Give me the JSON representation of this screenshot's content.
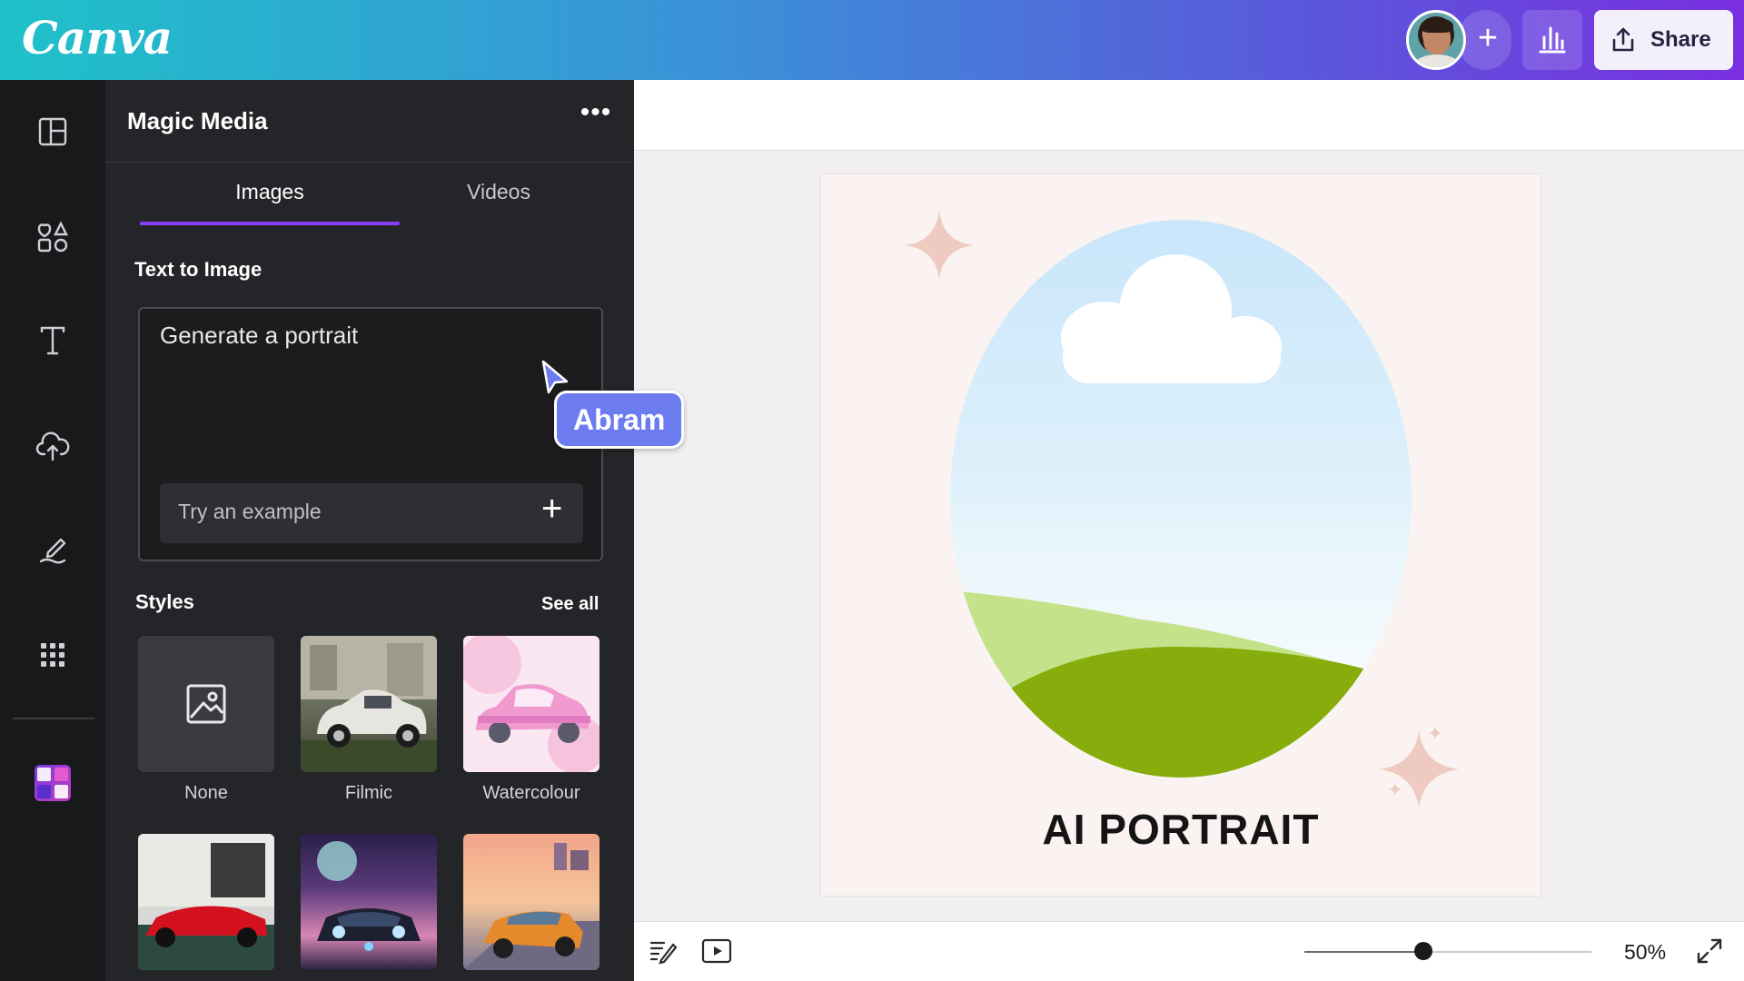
{
  "app": {
    "logo": "Canva"
  },
  "topbar": {
    "share_label": "Share",
    "add_symbol": "+"
  },
  "panel": {
    "title": "Magic Media",
    "more_symbol": "•••",
    "tabs": [
      {
        "label": "Images",
        "active": true
      },
      {
        "label": "Videos",
        "active": false
      }
    ],
    "text_to_image": {
      "heading": "Text to Image",
      "prompt_value": "Generate a portrait",
      "example_label": "Try an example",
      "example_symbol": "+"
    },
    "styles": {
      "heading": "Styles",
      "see_all": "See all",
      "items": [
        {
          "label": "None"
        },
        {
          "label": "Filmic"
        },
        {
          "label": "Watercolour"
        },
        {
          "label": ""
        },
        {
          "label": ""
        },
        {
          "label": ""
        }
      ]
    }
  },
  "collaborator": {
    "name": "Abram"
  },
  "canvas": {
    "title": "AI PORTRAIT"
  },
  "bottombar": {
    "zoom_label": "50%",
    "zoom_percent": 50
  },
  "colors": {
    "accent": "#8b3dff",
    "cursor_tag": "#6c7cf0",
    "panel_bg": "#242528",
    "rail_bg": "#18191b"
  },
  "icons": [
    "layout-icon",
    "elements-icon",
    "text-icon",
    "upload-icon",
    "draw-icon",
    "apps-icon",
    "magic-media-app-icon",
    "insights-icon",
    "share-icon",
    "image-placeholder-icon",
    "notes-icon",
    "present-icon",
    "fullscreen-icon"
  ]
}
